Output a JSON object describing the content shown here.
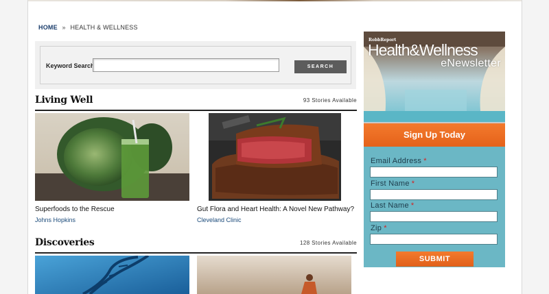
{
  "breadcrumb": {
    "home": "HOME",
    "separator": "»",
    "current": "HEALTH & WELLNESS"
  },
  "search": {
    "label": "Keyword Search:",
    "value": "",
    "placeholder": "",
    "button": "SEARCH"
  },
  "sections": [
    {
      "title": "Living Well",
      "count": "93 Stories Available",
      "stories": [
        {
          "title": "Superfoods to the Rescue",
          "source": "Johns Hopkins"
        },
        {
          "title": "Gut Flora and Heart Health: A Novel New Pathway?",
          "source": "Cleveland Clinic"
        }
      ]
    },
    {
      "title": "Discoveries",
      "count": "128 Stories Available",
      "stories": [
        {
          "title": "",
          "source": ""
        },
        {
          "title": "",
          "source": ""
        }
      ]
    }
  ],
  "ad": {
    "brand": "RobbReport",
    "title": "Health&Wellness",
    "subtitle": "eNewsletter",
    "cta": "Sign Up Today",
    "fields": [
      {
        "label": "Email Address",
        "required": "*",
        "value": ""
      },
      {
        "label": "First Name",
        "required": "*",
        "value": ""
      },
      {
        "label": "Last Name",
        "required": "*",
        "value": ""
      },
      {
        "label": "Zip",
        "required": "*",
        "value": ""
      }
    ],
    "submit": "SUBMIT"
  },
  "colors": {
    "accent_orange": "#e5621a",
    "ad_teal": "#6bb7c5",
    "link_blue": "#1a4a7a",
    "required_red": "#d62020"
  }
}
